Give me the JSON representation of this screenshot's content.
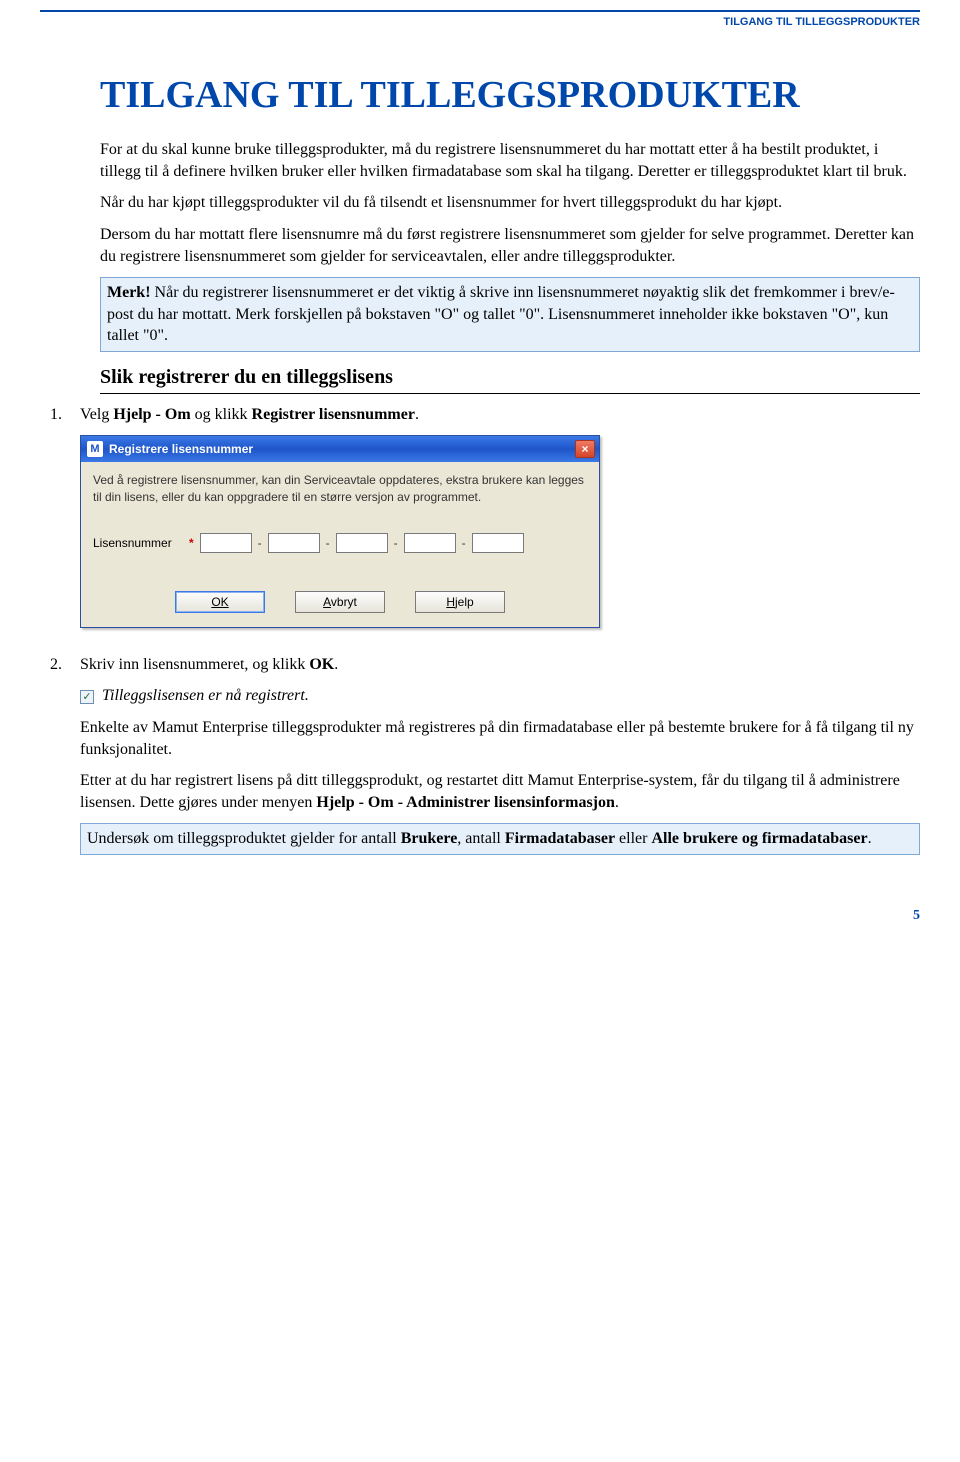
{
  "header": {
    "section_label": "TILGANG TIL TILLEGGSPRODUKTER"
  },
  "title": "TILGANG TIL TILLEGGSPRODUKTER",
  "para1": "For at du skal kunne bruke tilleggsprodukter, må du registrere lisensnummeret du har mottatt etter å ha bestilt produktet, i tillegg til å definere hvilken bruker eller hvilken firmadatabase som skal ha tilgang. Deretter er tilleggsproduktet klart til bruk.",
  "para2": "Når du har kjøpt tilleggsprodukter vil du få tilsendt et lisensnummer for hvert tilleggsprodukt du har kjøpt.",
  "para3": "Dersom du har mottatt flere lisensnumre må du først registrere lisensnummeret som gjelder for selve programmet. Deretter kan du registrere lisensnummeret som gjelder for serviceavtalen, eller andre tilleggsprodukter.",
  "note1_bold": "Merk!",
  "note1_rest": " Når du registrerer lisensnummeret er det viktig å skrive inn lisensnummeret nøyaktig slik det fremkommer i brev/e-post du har mottatt. Merk forskjellen på bokstaven \"O\" og tallet \"0\". Lisensnummeret inneholder ikke bokstaven \"O\", kun tallet \"0\".",
  "subhead": "Slik registrerer du en tilleggslisens",
  "steps": {
    "s1_num": "1.",
    "s1_a": "Velg ",
    "s1_b": "Hjelp - Om",
    "s1_c": " og klikk ",
    "s1_d": "Registrer lisensnummer",
    "s1_e": ".",
    "s2_num": "2.",
    "s2_a": "Skriv inn lisensnummeret, og klikk ",
    "s2_b": "OK",
    "s2_c": "."
  },
  "dialog": {
    "title": "Registrere lisensnummer",
    "icon_letter": "M",
    "close_glyph": "×",
    "body_text": "Ved å registrere lisensnummer, kan din Serviceavtale oppdateres, ekstra brukere kan legges til din lisens, eller du kan oppgradere til en større versjon av programmet.",
    "field_label": "Lisensnummer",
    "asterisk": "*",
    "sep": "-",
    "buttons": {
      "ok": "OK",
      "cancel": "Avbryt",
      "help": "Hjelp"
    }
  },
  "post": {
    "registered": "Tilleggslisensen er nå registrert.",
    "p1": "Enkelte av Mamut Enterprise tilleggsprodukter må registreres på din firmadatabase eller på bestemte brukere for å få tilgang til ny funksjonalitet.",
    "p2a": "Etter at du har registrert lisens på ditt tilleggsprodukt, og restartet ditt Mamut Enterprise-system, får du tilgang til å administrere lisensen. Dette gjøres under menyen ",
    "p2b": "Hjelp - Om - Administrer lisensinformasjon",
    "p2c": ".",
    "note2_a": "Undersøk om tilleggsproduktet gjelder for antall ",
    "note2_b": "Brukere",
    "note2_c": ", antall ",
    "note2_d": "Firmadatabaser",
    "note2_e": " eller ",
    "note2_f": "Alle brukere og firmadatabaser",
    "note2_g": "."
  },
  "page_number": "5",
  "check_glyph": "✓"
}
